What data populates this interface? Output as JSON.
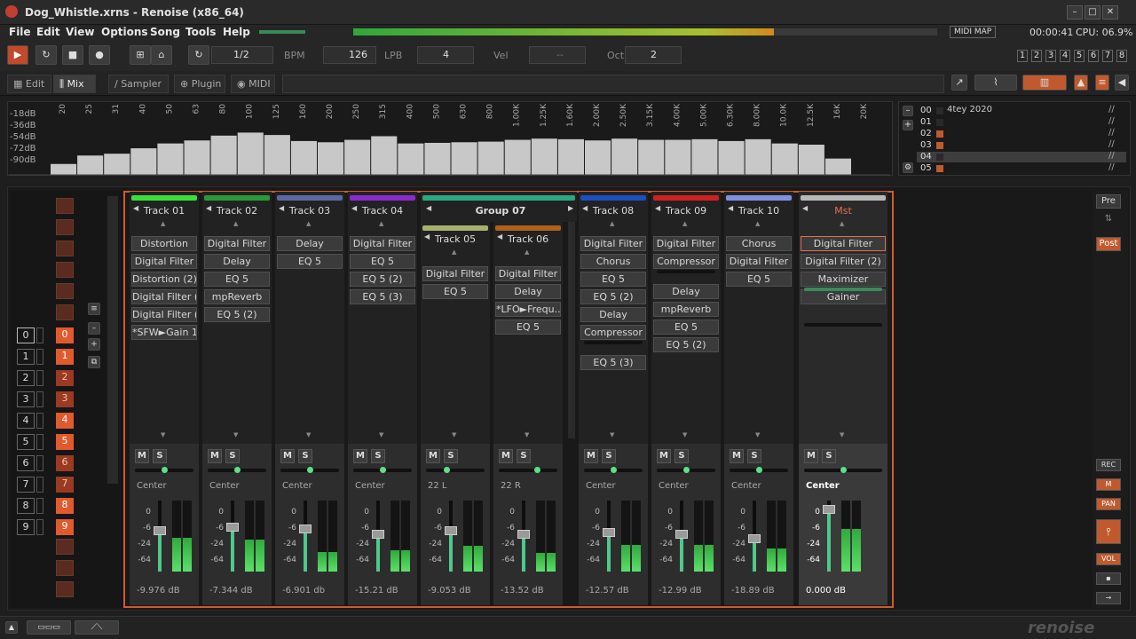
{
  "window": {
    "title": "Dog_Whistle.xrns - Renoise (x86_64)",
    "minimize": "–",
    "maximize": "□",
    "close": "✕"
  },
  "menu": [
    "File",
    "Edit",
    "View",
    "Options",
    "Song",
    "Tools",
    "Help"
  ],
  "toolbar": {
    "play": "▶",
    "loop": "↻",
    "stop": "■",
    "record": "●",
    "pattern_loop": "1/2",
    "bpm_label": "BPM",
    "bpm": "126",
    "lpb_label": "LPB",
    "lpb": "4",
    "vel_label": "Vel",
    "vel": "--",
    "oct_label": "Oct",
    "oct": "2",
    "midi_map": "MIDI MAP",
    "time": "00:00:41",
    "cpu": "CPU: 06.9%",
    "track_buttons": [
      "1",
      "2",
      "3",
      "4",
      "5",
      "6",
      "7",
      "8"
    ]
  },
  "tabs": [
    {
      "label": "Edit",
      "icon": "edit-icon"
    },
    {
      "label": "Mix",
      "icon": "mix-icon",
      "active": true
    },
    {
      "label": "Sampler",
      "icon": "sampler-icon"
    },
    {
      "label": "Plugin",
      "icon": "plugin-icon"
    },
    {
      "label": "MIDI",
      "icon": "midi-icon"
    }
  ],
  "spectrum": {
    "db_labels": [
      "-18dB",
      "-36dB",
      "-54dB",
      "-72dB",
      "-90dB"
    ],
    "freq_labels": [
      "20",
      "25",
      "31",
      "40",
      "50",
      "63",
      "80",
      "100",
      "125",
      "160",
      "200",
      "250",
      "315",
      "400",
      "500",
      "630",
      "800",
      "1.00K",
      "1.25K",
      "1.60K",
      "2.00K",
      "2.50K",
      "3.15K",
      "4.00K",
      "5.00K",
      "6.30K",
      "8.00K",
      "10.0K",
      "12.5K",
      "16K",
      "20K"
    ],
    "levels": [
      0.18,
      0.32,
      0.35,
      0.44,
      0.52,
      0.57,
      0.65,
      0.7,
      0.66,
      0.56,
      0.54,
      0.58,
      0.64,
      0.52,
      0.53,
      0.54,
      0.55,
      0.58,
      0.6,
      0.59,
      0.57,
      0.6,
      0.58,
      0.58,
      0.59,
      0.56,
      0.59,
      0.52,
      0.5,
      0.27
    ]
  },
  "instruments": {
    "title": "4tey 2020",
    "rows": [
      {
        "num": "00",
        "color": "#2a2a2a"
      },
      {
        "num": "01",
        "color": "#2a2a2a"
      },
      {
        "num": "02",
        "color": "#c05a2e"
      },
      {
        "num": "03",
        "color": "#c05a2e"
      },
      {
        "num": "04",
        "color": "#2a2a2a",
        "selected": true
      },
      {
        "num": "05",
        "color": "#c05a2e"
      }
    ]
  },
  "sequencer": {
    "rows": [
      {
        "idx": "0",
        "num": "0",
        "bright": true
      },
      {
        "idx": "1",
        "num": "1",
        "bright": true
      },
      {
        "idx": "2",
        "num": "2",
        "bright": false
      },
      {
        "idx": "3",
        "num": "3",
        "bright": false
      },
      {
        "idx": "4",
        "num": "4",
        "bright": true
      },
      {
        "idx": "5",
        "num": "5",
        "bright": true
      },
      {
        "idx": "6",
        "num": "6",
        "bright": false
      },
      {
        "idx": "7",
        "num": "7",
        "bright": false
      },
      {
        "idx": "8",
        "num": "8",
        "bright": true
      },
      {
        "idx": "9",
        "num": "9",
        "bright": true
      }
    ]
  },
  "tracks": [
    {
      "name": "Track 01",
      "color": "#39e03a",
      "devices": [
        "Distortion",
        "Digital Filter",
        "Distortion (2)",
        "Digital Filter (2)",
        "Digital Filter (3)",
        "*SFW►Gain 1..."
      ],
      "pan": "Center",
      "db": "-9.976 dB",
      "fader": 0.58,
      "vu": 0.48
    },
    {
      "name": "Track 02",
      "color": "#2a9a38",
      "devices": [
        "Digital Filter",
        "Delay",
        "EQ 5",
        "mpReverb",
        "EQ 5 (2)"
      ],
      "pan": "Center",
      "db": "-7.344 dB",
      "fader": 0.62,
      "vu": 0.45
    },
    {
      "name": "Track 03",
      "color": "#5a6aa0",
      "devices": [
        "Delay",
        "EQ 5"
      ],
      "pan": "Center",
      "db": "-6.901 db",
      "fader": 0.6,
      "vu": 0.28
    },
    {
      "name": "Track 04",
      "color": "#8a2ad0",
      "devices": [
        "Digital Filter",
        "EQ 5",
        "EQ 5 (2)",
        "EQ 5 (3)"
      ],
      "pan": "Center",
      "db": "-15.21 dB",
      "fader": 0.52,
      "vu": 0.3
    },
    {
      "name": "Track 05",
      "color": "#a8b070",
      "devices": [
        "Digital Filter",
        "EQ 5"
      ],
      "pan": "22 L",
      "db": "-9.053 dB",
      "fader": 0.58,
      "vu": 0.36
    },
    {
      "name": "Track 06",
      "color": "#b0601a",
      "devices": [
        "Digital Filter",
        "Delay",
        "*LFO►Frequ...",
        "EQ 5"
      ],
      "pan": "22 R",
      "db": "-13.52 dB",
      "fader": 0.52,
      "vu": 0.26
    },
    {
      "name": "Track 08",
      "color": "#1a50c0",
      "devices": [
        "Digital Filter",
        "Chorus",
        "EQ 5",
        "EQ 5 (2)",
        "Delay",
        "Compressor",
        "EQ 5 (3)"
      ],
      "pan": "Center",
      "db": "-12.57 dB",
      "fader": 0.55,
      "vu": 0.38
    },
    {
      "name": "Track 09",
      "color": "#d02020",
      "devices": [
        "Digital Filter",
        "Compressor",
        "Delay",
        "mpReverb",
        "EQ 5",
        "EQ 5 (2)"
      ],
      "pan": "Center",
      "db": "-12.99 dB",
      "fader": 0.53,
      "vu": 0.38
    },
    {
      "name": "Track 10",
      "color": "#8090e0",
      "devices": [
        "Chorus",
        "Digital Filter",
        "EQ 5"
      ],
      "pan": "Center",
      "db": "-18.89 dB",
      "fader": 0.46,
      "vu": 0.32
    },
    {
      "name": "Mst",
      "color": "#b8b8b8",
      "devices": [
        "Digital Filter",
        "Digital Filter (2)",
        "Maximizer",
        "Gainer"
      ],
      "pan": "Center",
      "db": "0.000 dB",
      "fader": 0.88,
      "vu": 0.6
    }
  ],
  "group": {
    "name": "Group 07",
    "color": "#2aa880"
  },
  "mute_label": "M",
  "solo_label": "S",
  "fader_scale": [
    "0",
    "-6",
    "-24",
    "-64"
  ],
  "side": {
    "pre": "Pre",
    "post": "Post",
    "labels": [
      "REC",
      "M",
      "PAN",
      "VOL"
    ]
  },
  "status": {
    "logo": "renoise"
  }
}
